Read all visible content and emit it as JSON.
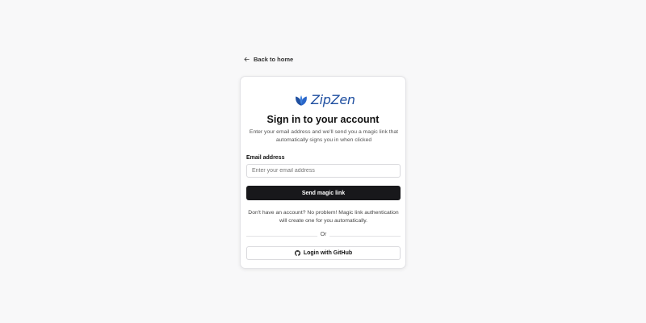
{
  "nav": {
    "back_label": "Back to home"
  },
  "brand": {
    "name": "ZipZen",
    "color": "#1f4fa0",
    "icon": "leaf-logo-icon"
  },
  "header": {
    "title": "Sign in to your account",
    "subtitle": "Enter your email address and we'll send you a magic link that automatically signs you in when clicked"
  },
  "form": {
    "email_label": "Email address",
    "email_value": "",
    "email_placeholder": "Enter your email address",
    "submit_label": "Send magic link"
  },
  "info_text": "Don't have an account? No problem! Magic link authentication will create one for you automatically.",
  "divider_label": "Or",
  "oauth": {
    "github_label": "Login with GitHub",
    "icon": "github-icon"
  },
  "colors": {
    "primary_button": "#18181b",
    "background": "#f8f8f9"
  }
}
